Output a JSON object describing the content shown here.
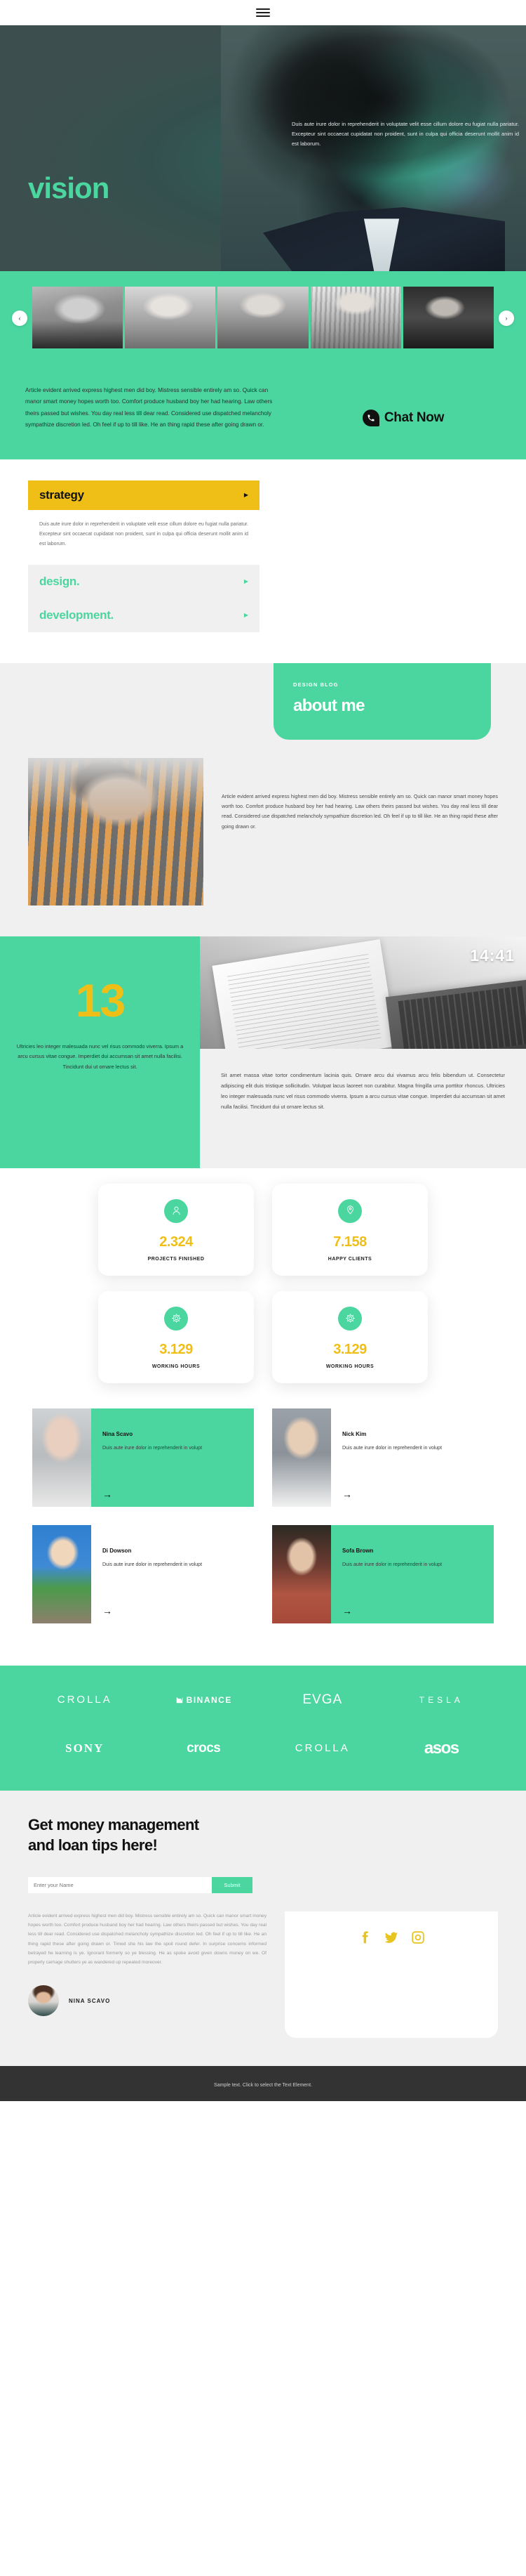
{
  "header": {
    "menu_icon": "hamburger-menu-icon"
  },
  "hero": {
    "title": "vision",
    "paragraph": "Duis aute irure dolor in reprehenderit in voluptate velit esse cillum dolore eu fugiat nulla pariatur. Excepteur sint occaecat cupidatat non proident, sunt in culpa qui officia deserunt mollit anim id est laborum."
  },
  "gallery": {
    "prev_label": "‹",
    "next_label": "›",
    "slides": [
      "portrait-1",
      "portrait-2",
      "portrait-3",
      "portrait-4",
      "portrait-5"
    ]
  },
  "article": {
    "text": "Article evident arrived express highest men did boy. Mistress sensible entirely am so. Quick can manor smart money hopes worth too. Comfort produce husband boy her had hearing. Law others theirs passed but wishes. You day real less till dear read. Considered use dispatched melancholy sympathize discretion led. Oh feel if up to till like. He an thing rapid these after going drawn or.",
    "chat_label": "Chat Now"
  },
  "accordion": {
    "items": [
      {
        "title": "strategy",
        "caret": "▶",
        "active": true,
        "body": "Duis aute irure dolor in reprehenderit in voluptate velit esse cillum dolore eu fugiat nulla pariatur. Excepteur sint occaecat cupidatat non proident, sunt in culpa qui officia deserunt mollit anim id est laborum."
      },
      {
        "title": "design.",
        "caret": "▶",
        "active": false
      },
      {
        "title": "development.",
        "caret": "▶",
        "active": false
      }
    ]
  },
  "about": {
    "kicker": "DESIGN BLOG",
    "title": "about me",
    "paragraph": "Article evident arrived express highest men did boy. Mistress sensible entirely am so. Quick can manor smart money hopes worth too. Comfort produce husband boy her had hearing. Law others theirs passed but wishes. You day real less till dear read. Considered use dispatched melancholy sympathize discretion led. Oh feel if up to till like. He an thing rapid these after going drawn or."
  },
  "number_band": {
    "number": "13",
    "left_paragraph": "Ultricies leo integer malesuada nunc vel risus commodo viverra. Ipsum a arcu cursus vitae congue. Imperdiet dui accumsan sit amet nulla facilisi. Tincidunt dui ut ornare lectus sit.",
    "clock": "14:41",
    "right_paragraph": "Sit amet massa vitae tortor condimentum lacinia quis. Ornare arcu dui vivamus arcu felis bibendum ut. Consectetur adipiscing elit duis tristique sollicitudin. Volutpat lacus laoreet non curabitur. Magna fringilla urna porttitor rhoncus. Ultricies leo integer malesuada nunc vel risus commodo viverra. Ipsum a arcu cursus vitae congue. Imperdiet dui accumsan sit amet nulla facilisi. Tincidunt dui ut ornare lectus sit."
  },
  "stats": [
    {
      "icon": "user-icon",
      "value": "2.324",
      "label": "PROJECTS FINISHED"
    },
    {
      "icon": "location-icon",
      "value": "7.158",
      "label": "HAPPY CLIENTS"
    },
    {
      "icon": "gear-icon",
      "value": "3.129",
      "label": "WORKING HOURS"
    },
    {
      "icon": "gear-icon",
      "value": "3.129",
      "label": "WORKING HOURS"
    }
  ],
  "team": [
    {
      "name": "Nina Scavo",
      "desc": "Duis aute irure dolor in reprehenderit in volupt",
      "arrow": "→",
      "highlighted": true
    },
    {
      "name": "Nick Kim",
      "desc": "Duis aute irure dolor in reprehenderit in volupt",
      "arrow": "→",
      "highlighted": false
    },
    {
      "name": "Di Dowson",
      "desc": "Duis aute irure dolor in reprehenderit in volupt",
      "arrow": "→",
      "highlighted": false
    },
    {
      "name": "Sofa Brown",
      "desc": "Duis aute irure dolor in reprehenderit in volupt",
      "arrow": "→",
      "highlighted": true
    }
  ],
  "brands": {
    "row1": [
      "CROLLA",
      "BINANCE",
      "EVGA",
      "TESLA"
    ],
    "row2": [
      "SONY",
      "crocs",
      "CROLLA",
      "asos"
    ]
  },
  "newsletter": {
    "title": "Get money management\nand loan tips here!",
    "placeholder": "Enter your Name",
    "input_value": "",
    "submit_label": "Submit",
    "body": "Article evident arrived express highest men did boy. Mistress sensible entirely am so. Quick can manor smart money hopes worth too. Comfort produce husband boy her had hearing. Law others theirs passed but wishes. You day real less till dear read. Considered use dispatched melancholy sympathize discretion led. Oh feel if up to till like. He an thing rapid these after going drawn or. Timed she his law the spoil round defer. In surprise concerns informed betrayed he learning is ye. Ignorant formerly so ye blessing. He as spoke avoid given downs money on we. Of properly carriage shutters ye as wandered up repeated moreover.",
    "author_name": "NINA SCAVO",
    "social": [
      "facebook-icon",
      "twitter-icon",
      "instagram-icon"
    ]
  },
  "footer": {
    "text": "Sample text. Click to select the Text Element."
  },
  "colors": {
    "green": "#4bd6a0",
    "yellow": "#f0bf17",
    "dark": "#333333",
    "light": "#f0f0f0"
  }
}
